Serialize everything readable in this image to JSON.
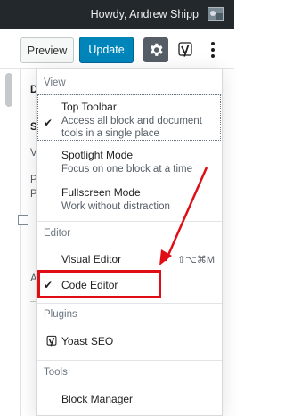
{
  "adminbar": {
    "greeting": "Howdy, Andrew Shipp"
  },
  "header": {
    "preview_label": "Preview",
    "update_label": "Update"
  },
  "background_sidebar": {
    "letters": [
      "D",
      "S",
      "V",
      "P",
      "P",
      "A"
    ]
  },
  "menu": {
    "view": {
      "title": "View",
      "items": [
        {
          "label": "Top Toolbar",
          "description": "Access all block and document tools in a single place",
          "checked": "✔"
        },
        {
          "label": "Spotlight Mode",
          "description": "Focus on one block at a time"
        },
        {
          "label": "Fullscreen Mode",
          "description": "Work without distraction"
        }
      ]
    },
    "editor": {
      "title": "Editor",
      "items": [
        {
          "label": "Visual Editor",
          "shortcut": "⇧⌥⌘M"
        },
        {
          "label": "Code Editor",
          "checked": "✔"
        }
      ]
    },
    "plugins": {
      "title": "Plugins",
      "items": [
        {
          "label": "Yoast SEO"
        }
      ]
    },
    "tools": {
      "title": "Tools",
      "items": [
        {
          "label": "Block Manager"
        }
      ]
    }
  },
  "colors": {
    "adminbar": "#23282d",
    "update_button": "#0085ba",
    "highlight": "#e10d15"
  }
}
